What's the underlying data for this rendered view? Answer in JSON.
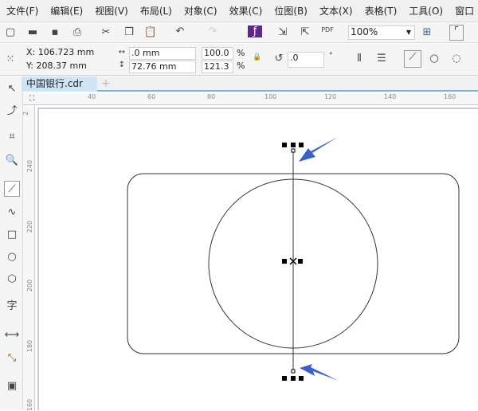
{
  "menu": [
    "文件(F)",
    "编辑(E)",
    "视图(V)",
    "布局(L)",
    "对象(C)",
    "效果(C)",
    "位图(B)",
    "文本(X)",
    "表格(T)",
    "工具(O)",
    "窗口"
  ],
  "toolbar": {
    "zoom": "100%"
  },
  "props": {
    "x": "X: 106.723 mm",
    "y": "Y: 208.37 mm",
    "width": ".0 mm",
    "height": "72.76 mm",
    "scale_x": "100.0",
    "scale_y": "121.3",
    "pct": "%",
    "angle": ".0",
    "deg": "°"
  },
  "tab": {
    "name": "中国银行.cdr",
    "add": "+"
  },
  "ruler": {
    "h": [
      "40",
      "60",
      "80",
      "100",
      "120",
      "140",
      "160"
    ],
    "v": [
      "240",
      "220",
      "200",
      "180",
      "160"
    ],
    "corner": "2"
  },
  "colors": {
    "arrow": "#3b5fcf",
    "accent": "#7cb4d8"
  }
}
